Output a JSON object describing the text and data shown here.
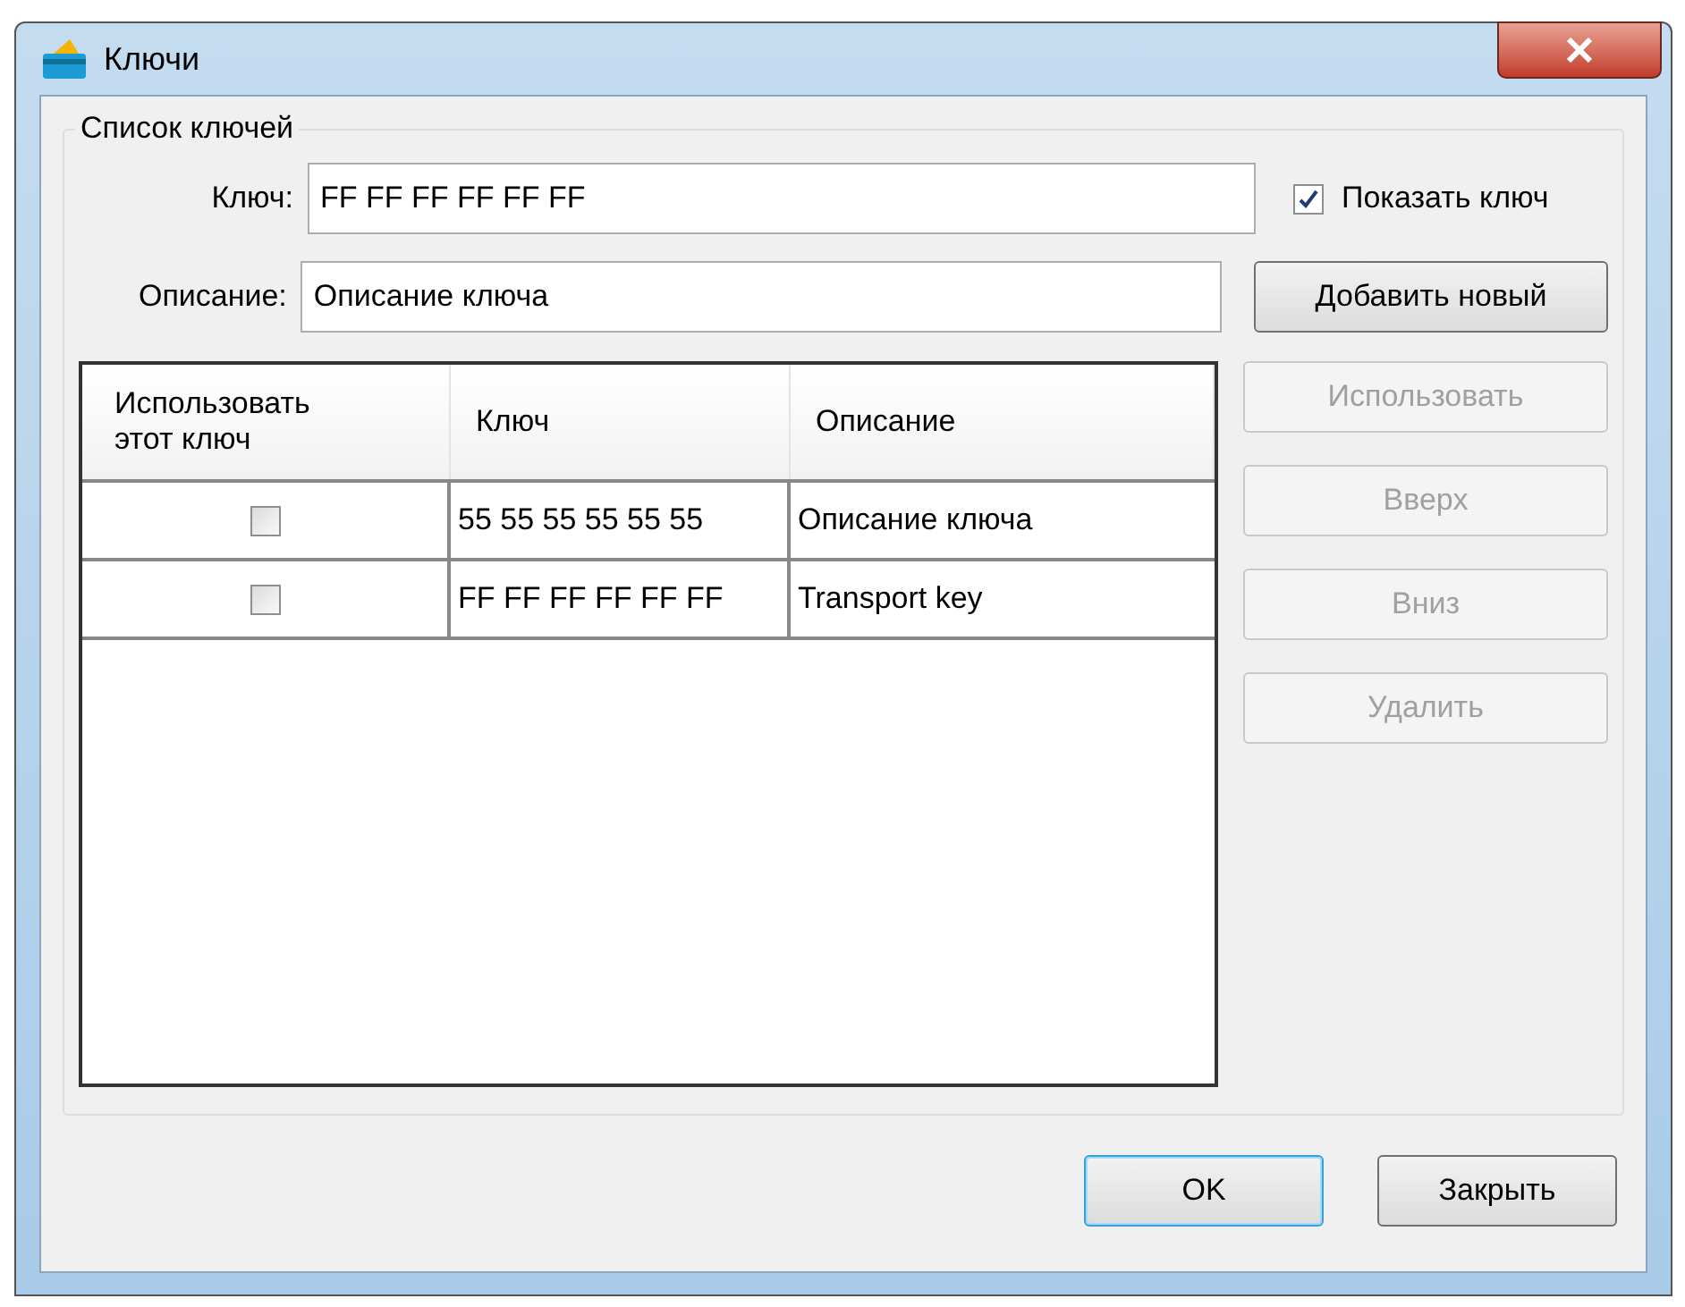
{
  "window": {
    "title": "Ключи"
  },
  "group": {
    "title": "Список ключей"
  },
  "key_field": {
    "label": "Ключ:",
    "value": "FF FF FF FF FF FF"
  },
  "show_key": {
    "label": "Показать ключ",
    "checked": true
  },
  "description_field": {
    "label": "Описание:",
    "value": "Описание ключа"
  },
  "add_button": {
    "label": "Добавить новый",
    "disabled": false
  },
  "table": {
    "columns": [
      "Использовать этот ключ",
      "Ключ",
      "Описание"
    ],
    "rows": [
      {
        "use": false,
        "key": "55 55 55 55 55 55",
        "description": "Описание ключа"
      },
      {
        "use": false,
        "key": "FF FF FF FF FF FF",
        "description": "Transport key"
      }
    ]
  },
  "side_buttons": [
    {
      "label": "Использовать",
      "disabled": true
    },
    {
      "label": "Вверх",
      "disabled": true
    },
    {
      "label": "Вниз",
      "disabled": true
    },
    {
      "label": "Удалить",
      "disabled": true
    }
  ],
  "footer_buttons": [
    {
      "label": "OK",
      "kind": "default"
    },
    {
      "label": "Закрыть",
      "kind": "normal"
    }
  ]
}
